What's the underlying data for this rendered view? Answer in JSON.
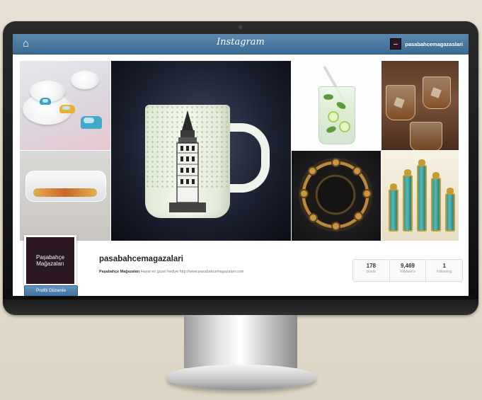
{
  "topbar": {
    "brand": "Instagram",
    "username_short": "pasabahcemagazaslari",
    "accent_color": "#3f6f98"
  },
  "photos": [
    {
      "subject": "toy-car-tableware"
    },
    {
      "subject": "ship-in-bottle"
    },
    {
      "subject": "galata-tower-mug"
    },
    {
      "subject": "lemonade-glass"
    },
    {
      "subject": "whisky-glasses"
    },
    {
      "subject": "ornate-plate"
    },
    {
      "subject": "turquoise-goblets"
    }
  ],
  "profile": {
    "avatar_text": "Paşabahçe Mağazaları",
    "username": "pasabahcemagazalari",
    "bio_name": "Paşabahçe Mağazaları",
    "bio_text": " Hayat en güzel hediye http://www.pasabahcemagazalari.com",
    "edit_button": "Profili Düzenle",
    "stats": [
      {
        "value": "178",
        "label": "posts"
      },
      {
        "value": "9,469",
        "label": "followers"
      },
      {
        "value": "1",
        "label": "following"
      }
    ]
  }
}
